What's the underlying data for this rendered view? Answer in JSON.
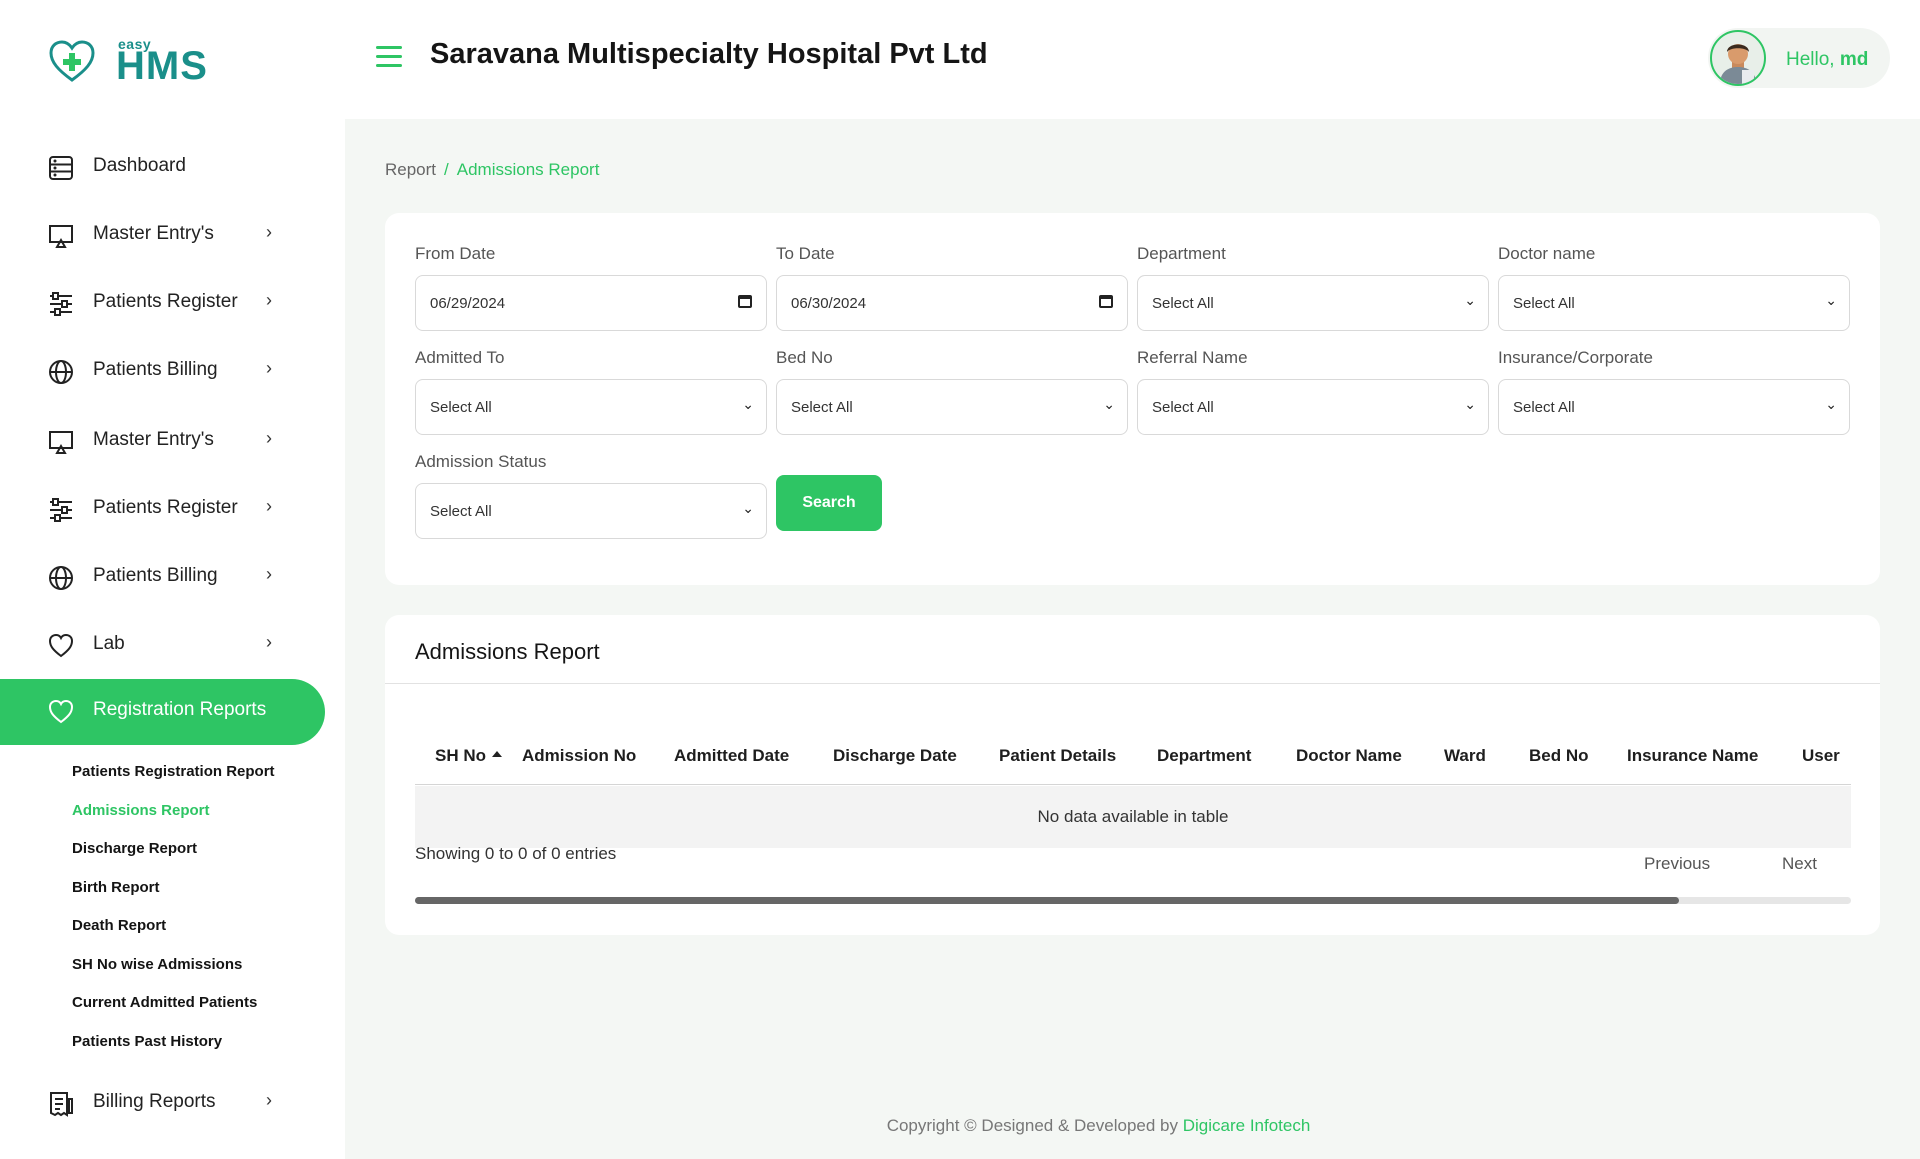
{
  "brand": {
    "small": "easy",
    "main": "HMS"
  },
  "header": {
    "title": "Saravana Multispecialty Hospital Pvt Ltd",
    "greeting": "Hello,",
    "username": "md"
  },
  "sidebar": {
    "items": [
      {
        "label": "Dashboard",
        "icon": "dashboard-icon",
        "chevron": false
      },
      {
        "label": "Master Entry's",
        "icon": "monitor-icon",
        "chevron": true
      },
      {
        "label": "Patients Register",
        "icon": "sliders-icon",
        "chevron": true
      },
      {
        "label": "Patients Billing",
        "icon": "globe-icon",
        "chevron": true
      },
      {
        "label": "Master Entry's",
        "icon": "monitor-icon",
        "chevron": true
      },
      {
        "label": "Patients Register",
        "icon": "sliders-icon",
        "chevron": true
      },
      {
        "label": "Patients Billing",
        "icon": "globe-icon",
        "chevron": true
      },
      {
        "label": "Lab",
        "icon": "heart-icon",
        "chevron": true
      },
      {
        "label": "Registration Reports",
        "icon": "heart-icon",
        "chevron": true,
        "active": true
      },
      {
        "label": "Billing Reports",
        "icon": "receipt-icon",
        "chevron": true
      }
    ],
    "sub_items": [
      "Patients Registration Report",
      "Admissions Report",
      "Discharge Report",
      "Birth Report",
      "Death Report",
      "SH No wise Admissions",
      "Current Admitted Patients",
      "Patients Past History"
    ],
    "current_sub": "Admissions Report"
  },
  "breadcrumb": {
    "parent": "Report",
    "separator": "/",
    "current": "Admissions Report"
  },
  "filters": {
    "from_date": {
      "label": "From Date",
      "value": "06/29/2024"
    },
    "to_date": {
      "label": "To Date",
      "value": "06/30/2024"
    },
    "department": {
      "label": "Department",
      "value": "Select All"
    },
    "doctor": {
      "label": "Doctor name",
      "value": "Select All"
    },
    "admitted_to": {
      "label": "Admitted To",
      "value": "Select All"
    },
    "bed_no": {
      "label": "Bed No",
      "value": "Select All"
    },
    "referral": {
      "label": "Referral Name",
      "value": "Select All"
    },
    "insurance": {
      "label": "Insurance/Corporate",
      "value": "Select All"
    },
    "status": {
      "label": "Admission Status",
      "value": "Select All"
    },
    "search_label": "Search"
  },
  "report": {
    "title": "Admissions Report",
    "columns": [
      "SH No",
      "Admission No",
      "Admitted Date",
      "Discharge Date",
      "Patient Details",
      "Department",
      "Doctor Name",
      "Ward",
      "Bed No",
      "Insurance Name",
      "User"
    ],
    "empty_text": "No data available in table",
    "info": "Showing 0 to 0 of 0 entries",
    "prev": "Previous",
    "next": "Next",
    "scroll_fraction": 0.88
  },
  "footer": {
    "text": "Copyright © Designed & Developed by",
    "brand": "Digicare Infotech"
  },
  "colors": {
    "accent": "#2ec564",
    "logo": "#1a8f8a"
  }
}
